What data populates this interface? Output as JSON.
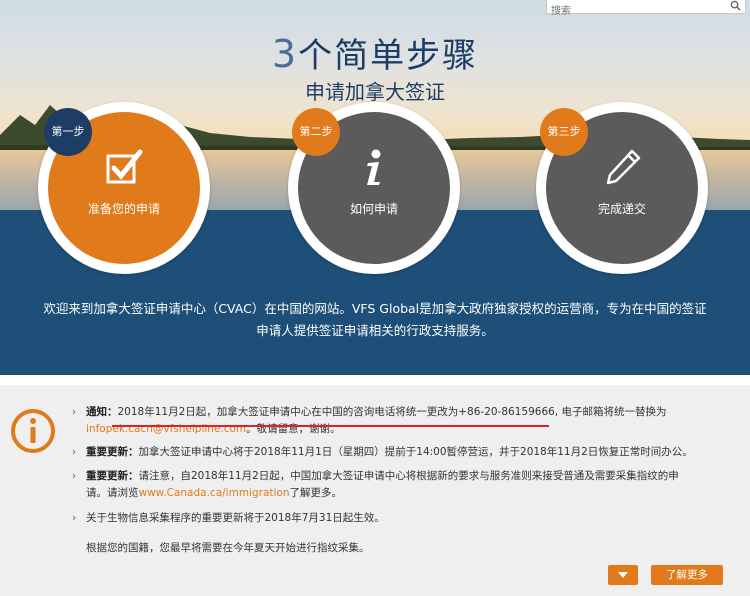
{
  "search": {
    "placeholder": "搜索"
  },
  "hero": {
    "title_num": "3",
    "title_rest": "个简单步骤",
    "subtitle": "申请加拿大签证",
    "steps": [
      {
        "badge": "第一步",
        "label": "准备您的申请",
        "icon": "checkbox-icon",
        "color": "#e07a1a",
        "badge_color": "#1d3d66"
      },
      {
        "badge": "第二步",
        "label": "如何申请",
        "icon": "info-i-icon",
        "color": "#5b5b5b",
        "badge_color": "#e07a1a"
      },
      {
        "badge": "第三步",
        "label": "完成递交",
        "icon": "pencil-icon",
        "color": "#5b5b5b",
        "badge_color": "#e07a1a"
      }
    ],
    "welcome_line1": "欢迎来到加拿大签证申请中心（CVAC）在中国的网站。VFS Global是加拿大政府独家授权的运营商，专为在中国的签证",
    "welcome_line2": "申请人提供签证申请相关的行政支持服务。"
  },
  "news": {
    "items": [
      {
        "bold": "通知：",
        "part1": "2018年11月2日起，加拿大签证申请中心在中国的咨询电话将统一更改为+86-20-86159666, 电子邮箱将统一替换为",
        "link": "infopek.cacn@vfshelpline.com",
        "part2": "。敬请留意，谢谢。"
      },
      {
        "bold": "重要更新：",
        "part1": "加拿大签证申请中心将于2018年11月1日（星期四）提前于14:00暂停营运，并于2018年11月2日恢复正常时间办公。"
      },
      {
        "bold": "重要更新：",
        "part1": "请注意，自2018年11月2日起，中国加拿大签证申请中心将根据新的要求与服务准则来接受普通及需要采集指纹的申",
        "part2a": "请。请浏览",
        "link": "www.Canada.ca/immigration",
        "part2b": "了解更多。"
      },
      {
        "part1": "关于生物信息采集程序的重要更新将于2018年7月31日起生效。"
      }
    ],
    "footer_text": "根据您的国籍，您最早将需要在今年夏天开始进行指纹采集。",
    "more_button": "了解更多"
  },
  "colors": {
    "accent": "#e07a1a",
    "navy": "#1d4f79",
    "title": "#1d3d66"
  }
}
